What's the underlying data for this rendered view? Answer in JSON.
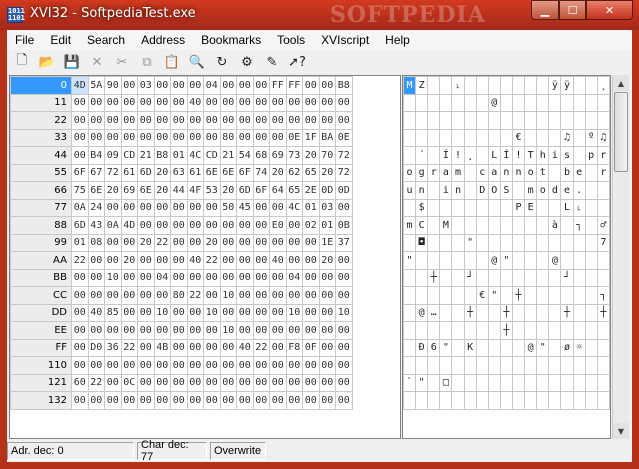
{
  "window": {
    "title": "XVI32 - SoftpediaTest.exe",
    "watermark": "SOFTPEDIA",
    "icon_text": "1011 1101"
  },
  "menu": [
    "File",
    "Edit",
    "Search",
    "Address",
    "Bookmarks",
    "Tools",
    "XVIscript",
    "Help"
  ],
  "toolbar": [
    {
      "icon": "new-file-icon",
      "glyph": "🗋",
      "enabled": true
    },
    {
      "icon": "open-folder-icon",
      "glyph": "📂",
      "enabled": true
    },
    {
      "icon": "save-disk-icon",
      "glyph": "💾",
      "enabled": true
    },
    {
      "icon": "delete-x-icon",
      "glyph": "✕",
      "enabled": false
    },
    {
      "icon": "cut-scissors-icon",
      "glyph": "✂",
      "enabled": false
    },
    {
      "icon": "copy-icon",
      "glyph": "⧉",
      "enabled": false
    },
    {
      "icon": "paste-clipboard-icon",
      "glyph": "📋",
      "enabled": true
    },
    {
      "icon": "find-magnifier-icon",
      "glyph": "🔍",
      "enabled": true
    },
    {
      "icon": "replace-icon",
      "glyph": "↻",
      "enabled": true
    },
    {
      "icon": "settings-icon",
      "glyph": "⚙",
      "enabled": true
    },
    {
      "icon": "script-icon",
      "glyph": "✎",
      "enabled": true
    },
    {
      "icon": "help-pointer-icon",
      "glyph": "➚?",
      "enabled": true
    }
  ],
  "rows": [
    {
      "addr": "0",
      "hex": [
        "4D",
        "5A",
        "90",
        "00",
        "03",
        "00",
        "00",
        "00",
        "04",
        "00",
        "00",
        "00",
        "FF",
        "FF",
        "00",
        "00",
        "B8"
      ],
      "text": [
        "M",
        "Z",
        "",
        "",
        "˪",
        "",
        "",
        "",
        "",
        "",
        "",
        "",
        "ÿ",
        "ÿ",
        "",
        "",
        "¸"
      ]
    },
    {
      "addr": "11",
      "hex": [
        "00",
        "00",
        "00",
        "00",
        "00",
        "00",
        "00",
        "40",
        "00",
        "00",
        "00",
        "00",
        "00",
        "00",
        "00",
        "00",
        "00"
      ],
      "text": [
        "",
        "",
        "",
        "",
        "",
        "",
        "",
        "@",
        "",
        "",
        "",
        "",
        "",
        "",
        "",
        "",
        ""
      ]
    },
    {
      "addr": "22",
      "hex": [
        "00",
        "00",
        "00",
        "00",
        "00",
        "00",
        "00",
        "00",
        "00",
        "00",
        "00",
        "00",
        "00",
        "00",
        "00",
        "00",
        "00"
      ],
      "text": [
        "",
        "",
        "",
        "",
        "",
        "",
        "",
        "",
        "",
        "",
        "",
        "",
        "",
        "",
        "",
        "",
        ""
      ]
    },
    {
      "addr": "33",
      "hex": [
        "00",
        "00",
        "00",
        "00",
        "00",
        "00",
        "00",
        "00",
        "00",
        "80",
        "00",
        "00",
        "00",
        "0E",
        "1F",
        "BA",
        "0E"
      ],
      "text": [
        "",
        "",
        "",
        "",
        "",
        "",
        "",
        "",
        "",
        "€",
        "",
        "",
        "",
        "♫",
        "",
        "º",
        "♫"
      ]
    },
    {
      "addr": "44",
      "hex": [
        "00",
        "B4",
        "09",
        "CD",
        "21",
        "B8",
        "01",
        "4C",
        "CD",
        "21",
        "54",
        "68",
        "69",
        "73",
        "20",
        "70",
        "72"
      ],
      "text": [
        "",
        "´",
        "",
        "Í",
        "!",
        "¸",
        "",
        "L",
        "Í",
        "!",
        "T",
        "h",
        "i",
        "s",
        "",
        "p",
        "r"
      ]
    },
    {
      "addr": "55",
      "hex": [
        "6F",
        "67",
        "72",
        "61",
        "6D",
        "20",
        "63",
        "61",
        "6E",
        "6E",
        "6F",
        "74",
        "20",
        "62",
        "65",
        "20",
        "72"
      ],
      "text": [
        "o",
        "g",
        "r",
        "a",
        "m",
        "",
        "c",
        "a",
        "n",
        "n",
        "o",
        "t",
        "",
        "b",
        "e",
        "",
        "r"
      ]
    },
    {
      "addr": "66",
      "hex": [
        "75",
        "6E",
        "20",
        "69",
        "6E",
        "20",
        "44",
        "4F",
        "53",
        "20",
        "6D",
        "6F",
        "64",
        "65",
        "2E",
        "0D",
        "0D"
      ],
      "text": [
        "u",
        "n",
        "",
        "i",
        "n",
        "",
        "D",
        "O",
        "S",
        "",
        "m",
        "o",
        "d",
        "e",
        ".",
        "",
        ""
      ]
    },
    {
      "addr": "77",
      "hex": [
        "0A",
        "24",
        "00",
        "00",
        "00",
        "00",
        "00",
        "00",
        "00",
        "50",
        "45",
        "00",
        "00",
        "4C",
        "01",
        "03",
        "00"
      ],
      "text": [
        "",
        "$",
        "",
        "",
        "",
        "",
        "",
        "",
        "",
        "P",
        "E",
        "",
        "",
        "L",
        "˪",
        "",
        ""
      ]
    },
    {
      "addr": "88",
      "hex": [
        "6D",
        "43",
        "0A",
        "4D",
        "00",
        "00",
        "00",
        "00",
        "00",
        "00",
        "00",
        "00",
        "E0",
        "00",
        "02",
        "01",
        "0B"
      ],
      "text": [
        "m",
        "C",
        "",
        "M",
        "",
        "",
        "",
        "",
        "",
        "",
        "",
        "",
        "à",
        "",
        "┐",
        "",
        "♂"
      ]
    },
    {
      "addr": "99",
      "hex": [
        "01",
        "08",
        "00",
        "00",
        "20",
        "22",
        "00",
        "00",
        "20",
        "00",
        "00",
        "00",
        "00",
        "00",
        "00",
        "1E",
        "37"
      ],
      "text": [
        "",
        "◘",
        "",
        "",
        "",
        "\"",
        "",
        "",
        "",
        "",
        "",
        "",
        "",
        "",
        "",
        "",
        "7"
      ]
    },
    {
      "addr": "AA",
      "hex": [
        "22",
        "00",
        "00",
        "20",
        "00",
        "00",
        "00",
        "40",
        "22",
        "00",
        "00",
        "00",
        "40",
        "00",
        "00",
        "20",
        "00"
      ],
      "text": [
        "\"",
        "",
        "",
        "",
        "",
        "",
        "",
        "@",
        "\"",
        "",
        "",
        "",
        "@",
        "",
        "",
        "",
        ""
      ]
    },
    {
      "addr": "BB",
      "hex": [
        "00",
        "00",
        "10",
        "00",
        "00",
        "04",
        "00",
        "00",
        "00",
        "00",
        "00",
        "00",
        "00",
        "04",
        "00",
        "00",
        "00"
      ],
      "text": [
        "",
        "",
        "┼",
        "",
        "",
        "┘",
        "",
        "",
        "",
        "",
        "",
        "",
        "",
        "┘",
        "",
        "",
        ""
      ]
    },
    {
      "addr": "CC",
      "hex": [
        "00",
        "00",
        "00",
        "00",
        "00",
        "00",
        "80",
        "22",
        "00",
        "10",
        "00",
        "00",
        "00",
        "00",
        "00",
        "00",
        "00"
      ],
      "text": [
        "",
        "",
        "",
        "",
        "",
        "",
        "€",
        "\"",
        "",
        "┼",
        "",
        "",
        "",
        "",
        "",
        "",
        "┐"
      ]
    },
    {
      "addr": "DD",
      "hex": [
        "00",
        "40",
        "85",
        "00",
        "00",
        "10",
        "00",
        "00",
        "10",
        "00",
        "00",
        "00",
        "00",
        "10",
        "00",
        "00",
        "10"
      ],
      "text": [
        "",
        "@",
        "…",
        "",
        "",
        "┼",
        "",
        "",
        "┼",
        "",
        "",
        "",
        "",
        "┼",
        "",
        "",
        "┼"
      ]
    },
    {
      "addr": "EE",
      "hex": [
        "00",
        "00",
        "00",
        "00",
        "00",
        "00",
        "00",
        "00",
        "00",
        "10",
        "00",
        "00",
        "00",
        "00",
        "00",
        "00",
        "00"
      ],
      "text": [
        "",
        "",
        "",
        "",
        "",
        "",
        "",
        "",
        "┼",
        "",
        "",
        "",
        "",
        "",
        "",
        "",
        ""
      ]
    },
    {
      "addr": "FF",
      "hex": [
        "00",
        "D0",
        "36",
        "22",
        "00",
        "4B",
        "00",
        "00",
        "00",
        "00",
        "40",
        "22",
        "00",
        "F8",
        "0F",
        "00",
        "00"
      ],
      "text": [
        "",
        "Ð",
        "6",
        "\"",
        "",
        "K",
        "",
        "",
        "",
        "",
        "@",
        "\"",
        "",
        "ø",
        "☼",
        "",
        ""
      ]
    },
    {
      "addr": "110",
      "hex": [
        "00",
        "00",
        "00",
        "00",
        "00",
        "00",
        "00",
        "00",
        "00",
        "00",
        "00",
        "00",
        "00",
        "00",
        "00",
        "00",
        "00"
      ],
      "text": [
        "",
        "",
        "",
        "",
        "",
        "",
        "",
        "",
        "",
        "",
        "",
        "",
        "",
        "",
        "",
        "",
        ""
      ]
    },
    {
      "addr": "121",
      "hex": [
        "60",
        "22",
        "00",
        "0C",
        "00",
        "00",
        "00",
        "00",
        "00",
        "00",
        "00",
        "00",
        "00",
        "00",
        "00",
        "00",
        "00"
      ],
      "text": [
        "`",
        "\"",
        "",
        "□",
        "",
        "",
        "",
        "",
        "",
        "",
        "",
        "",
        "",
        "",
        "",
        "",
        ""
      ]
    },
    {
      "addr": "132",
      "hex": [
        "00",
        "00",
        "00",
        "00",
        "00",
        "00",
        "00",
        "00",
        "00",
        "00",
        "00",
        "00",
        "00",
        "00",
        "00",
        "00",
        "00"
      ],
      "text": [
        "",
        "",
        "",
        "",
        "",
        "",
        "",
        "",
        "",
        "",
        "",
        "",
        "",
        "",
        "",
        "",
        ""
      ]
    }
  ],
  "status": {
    "address": "Adr. dec: 0",
    "char": "Char dec: 77",
    "mode": "Overwrite"
  }
}
